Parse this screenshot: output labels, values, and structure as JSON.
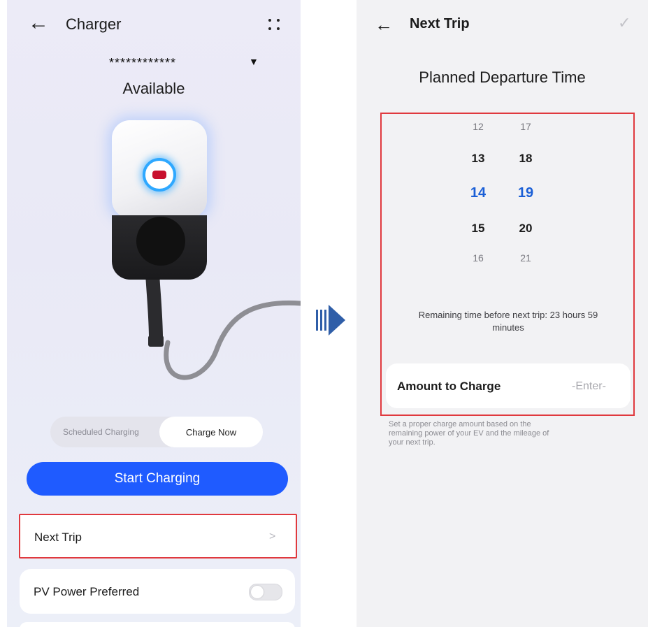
{
  "left_screen": {
    "header": {
      "back_icon": "arrow-left-icon",
      "title": "Charger",
      "more_icon": "dots-grid-icon"
    },
    "charger_id": "************",
    "dropdown_icon": "caret-down-icon",
    "status": "Available",
    "mode_tabs": {
      "scheduled": "Scheduled Charging",
      "now": "Charge Now",
      "selected": "Charge Now"
    },
    "start_button": "Start Charging",
    "next_trip": {
      "label": "Next Trip",
      "chevron": ">"
    },
    "pv_power": {
      "label": "PV Power Preferred",
      "enabled": false
    }
  },
  "right_screen": {
    "header": {
      "back_icon": "arrow-left-icon",
      "title": "Next Trip",
      "confirm_icon": "check-icon"
    },
    "heading": "Planned Departure Time",
    "hours": [
      "12",
      "13",
      "14",
      "15",
      "16"
    ],
    "minutes": [
      "17",
      "18",
      "19",
      "20",
      "21"
    ],
    "selected_hour": "14",
    "selected_minute": "19",
    "remaining_line1": "Remaining time before next trip: 23 hours 59",
    "remaining_line2": "minutes",
    "amount": {
      "label": "Amount to Charge",
      "placeholder": "-Enter-"
    },
    "note": [
      "Set a proper charge amount based on the",
      "remaining power of your EV and the mileage of",
      "your next trip."
    ]
  },
  "colors": {
    "accent": "#1f5bff",
    "selected": "#1a5fd6",
    "highlight": "#e0393e",
    "arrow": "#2f5ea8"
  }
}
